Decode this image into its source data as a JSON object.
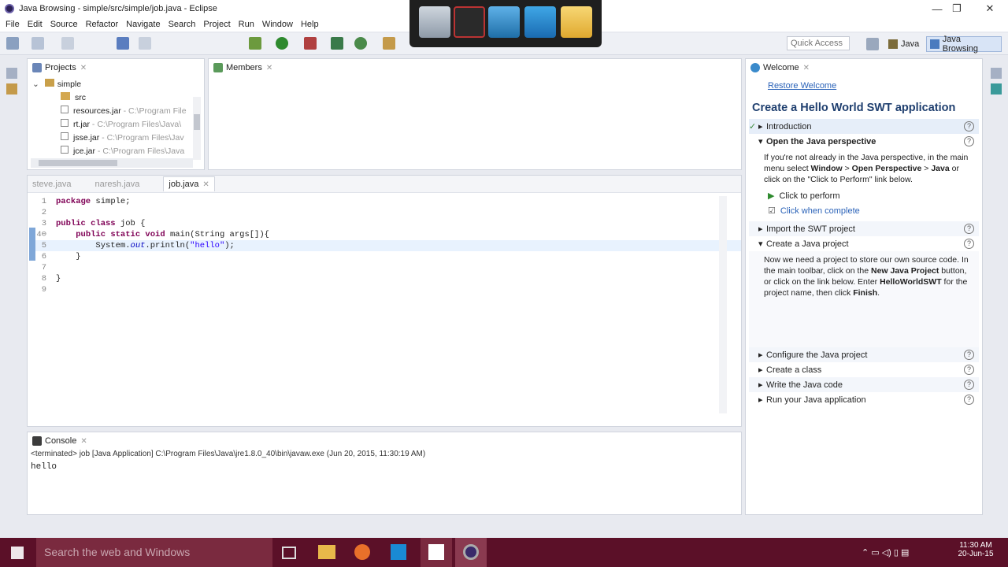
{
  "window": {
    "title": "Java Browsing - simple/src/simple/job.java - Eclipse",
    "minimize": "—",
    "maximize": "❐",
    "close": "✕"
  },
  "menu": [
    "File",
    "Edit",
    "Source",
    "Refactor",
    "Navigate",
    "Search",
    "Project",
    "Run",
    "Window",
    "Help"
  ],
  "toolbar": {
    "quick_access_placeholder": "Quick Access",
    "persp_java": "Java",
    "persp_browsing": "Java Browsing"
  },
  "projects": {
    "tab": "Projects",
    "items": [
      {
        "name": "simple",
        "path": ""
      },
      {
        "name": "src",
        "path": ""
      },
      {
        "name": "resources.jar",
        "path": " - C:\\Program File"
      },
      {
        "name": "rt.jar",
        "path": " - C:\\Program Files\\Java\\"
      },
      {
        "name": "jsse.jar",
        "path": " - C:\\Program Files\\Jav"
      },
      {
        "name": "jce.jar",
        "path": " - C:\\Program Files\\Java"
      }
    ]
  },
  "members": {
    "tab": "Members"
  },
  "editor": {
    "tabs": [
      "steve.java",
      "naresh.java",
      "job.java"
    ],
    "lines": [
      {
        "n": "1",
        "t": "package simple;"
      },
      {
        "n": "2",
        "t": ""
      },
      {
        "n": "3",
        "t": "public class job {"
      },
      {
        "n": "4⊖",
        "t": "    public static void main(String args[]){"
      },
      {
        "n": "5",
        "t": "        System.out.println(\"hello\");"
      },
      {
        "n": "6",
        "t": "    }"
      },
      {
        "n": "7",
        "t": ""
      },
      {
        "n": "8",
        "t": "}"
      },
      {
        "n": "9",
        "t": ""
      }
    ]
  },
  "console": {
    "tab": "Console",
    "status": "<terminated> job [Java Application] C:\\Program Files\\Java\\jre1.8.0_40\\bin\\javaw.exe (Jun 20, 2015, 11:30:19 AM)",
    "output": "hello"
  },
  "welcome": {
    "tab": "Welcome",
    "restore": "Restore Welcome",
    "heading": "Create a Hello World SWT application",
    "intro": "Introduction",
    "s1_title": "Open the Java perspective",
    "s1_a": "If you're not already in the Java perspective, in the main menu select ",
    "s1_b": "Window",
    "s1_c": " > ",
    "s1_d": "Open Perspective",
    "s1_e": " > ",
    "s1_f": "Java",
    "s1_g": " or click on the \"Click to Perform\" link below.",
    "click_perform": "Click to perform",
    "click_complete": "Click when complete",
    "s2": "Import the SWT project",
    "s3_title": "Create a Java project",
    "s3_a": "Now we need a project to store our own source code. In the main toolbar, click on the ",
    "s3_b": "New Java Project",
    "s3_c": " button, or click on the link below. Enter ",
    "s3_d": "HelloWorldSWT",
    "s3_e": " for the project name, then click ",
    "s3_f": "Finish",
    "s3_g": ".",
    "s4": "Configure the Java project",
    "s5": "Create a class",
    "s6": "Write the Java code",
    "s7": "Run your Java application"
  },
  "taskbar": {
    "search": "Search the web and Windows",
    "time": "11:30 AM",
    "date": "20-Jun-15"
  }
}
